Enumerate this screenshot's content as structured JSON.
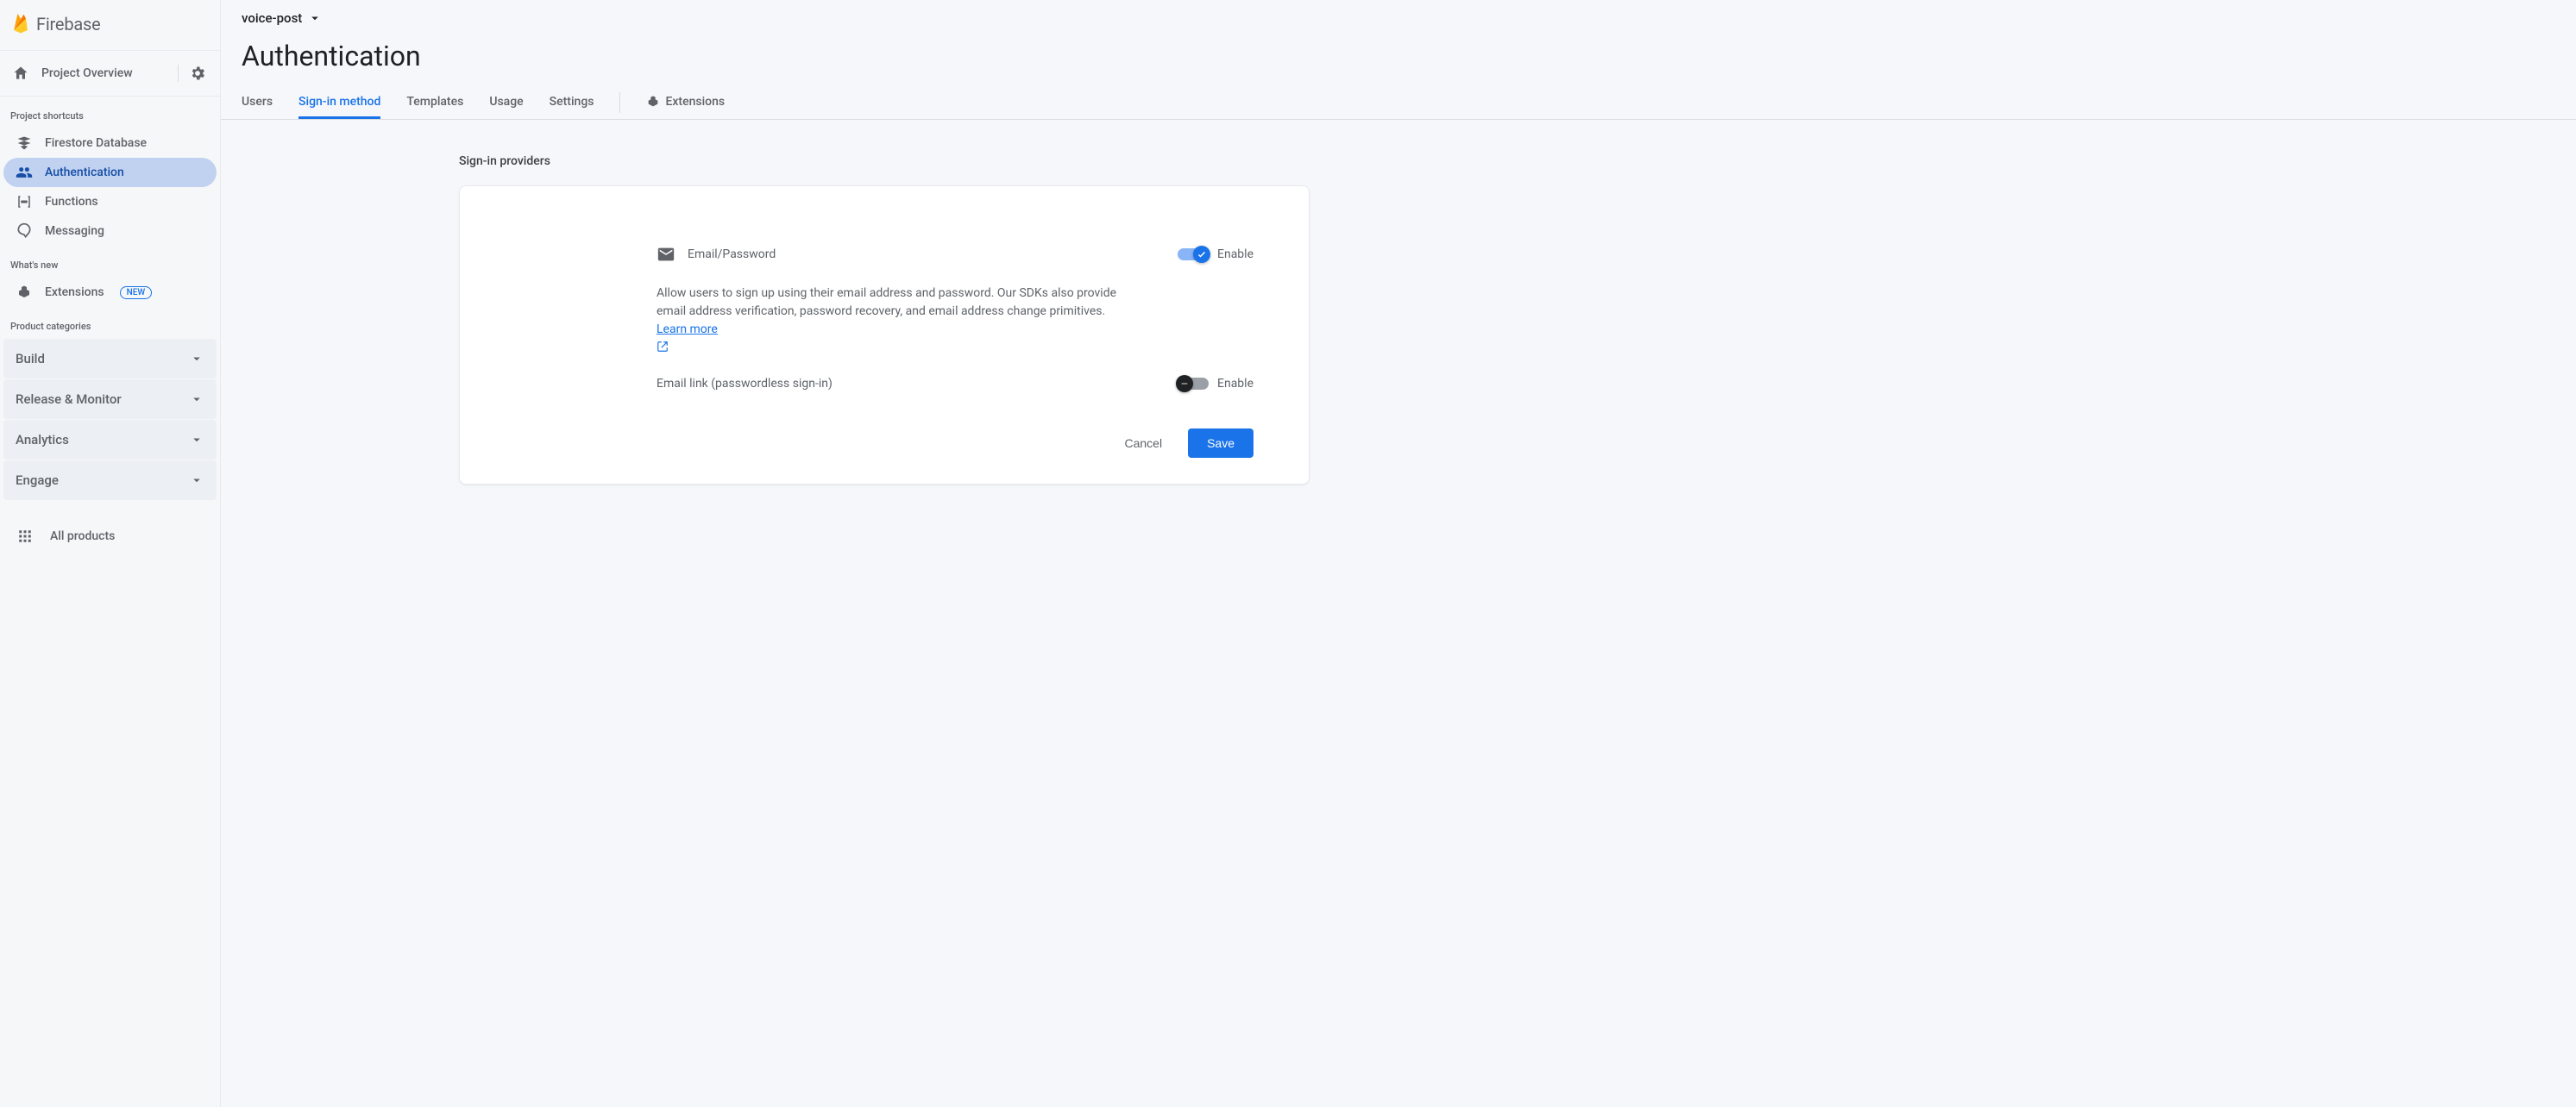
{
  "brand": "Firebase",
  "project_overview_label": "Project Overview",
  "sidebar": {
    "shortcuts_label": "Project shortcuts",
    "items": [
      {
        "label": "Firestore Database"
      },
      {
        "label": "Authentication"
      },
      {
        "label": "Functions"
      },
      {
        "label": "Messaging"
      }
    ],
    "whats_new_label": "What's new",
    "extensions_label": "Extensions",
    "extensions_badge": "NEW",
    "categories_label": "Product categories",
    "categories": [
      {
        "label": "Build"
      },
      {
        "label": "Release & Monitor"
      },
      {
        "label": "Analytics"
      },
      {
        "label": "Engage"
      }
    ],
    "all_products_label": "All products"
  },
  "project_name": "voice-post",
  "page_title": "Authentication",
  "tabs": [
    {
      "label": "Users"
    },
    {
      "label": "Sign-in method"
    },
    {
      "label": "Templates"
    },
    {
      "label": "Usage"
    },
    {
      "label": "Settings"
    },
    {
      "label": "Extensions"
    }
  ],
  "providers_heading": "Sign-in providers",
  "provider": {
    "name": "Email/Password",
    "enable_label": "Enable",
    "enabled": true,
    "description": "Allow users to sign up using their email address and password. Our SDKs also provide email address verification, password recovery, and email address change primitives. ",
    "learn_more": "Learn more",
    "email_link_label": "Email link (passwordless sign-in)",
    "email_link_enable_label": "Enable",
    "email_link_enabled": false
  },
  "actions": {
    "cancel": "Cancel",
    "save": "Save"
  }
}
